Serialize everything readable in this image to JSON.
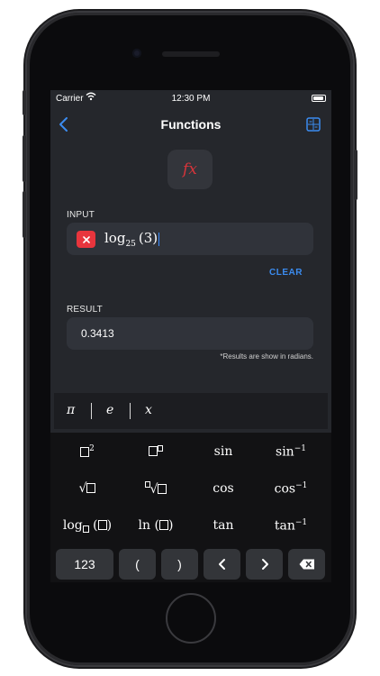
{
  "status_bar": {
    "carrier": "Carrier",
    "time": "12:30 PM"
  },
  "nav": {
    "title": "Functions",
    "back_icon": "chevron-left-icon",
    "right_icon": "calculator-icon"
  },
  "fx_icon_text": "fx",
  "input": {
    "label": "INPUT",
    "expression": {
      "fn": "log",
      "base": "25",
      "arg": "(3)"
    },
    "clear_label": "CLEAR"
  },
  "result": {
    "label": "RESULT",
    "value": "0.3413",
    "note": "*Results are show in radians."
  },
  "constants": [
    "π",
    "e",
    "x"
  ],
  "function_keys": {
    "row1": {
      "square_exp": "2",
      "sin": "sin",
      "asin": "sin",
      "asin_exp": "−1"
    },
    "row2": {
      "cos": "cos",
      "acos": "cos",
      "acos_exp": "−1"
    },
    "row3": {
      "log": "log",
      "ln": "ln",
      "tan": "tan",
      "atan": "tan",
      "atan_exp": "−1"
    }
  },
  "bottom_keys": {
    "mode": "123",
    "open_paren": "(",
    "close_paren": ")"
  },
  "colors": {
    "accent": "#3b8cf0",
    "danger": "#e8353d",
    "screen_bg": "#25272c",
    "field_bg": "#30333a"
  }
}
